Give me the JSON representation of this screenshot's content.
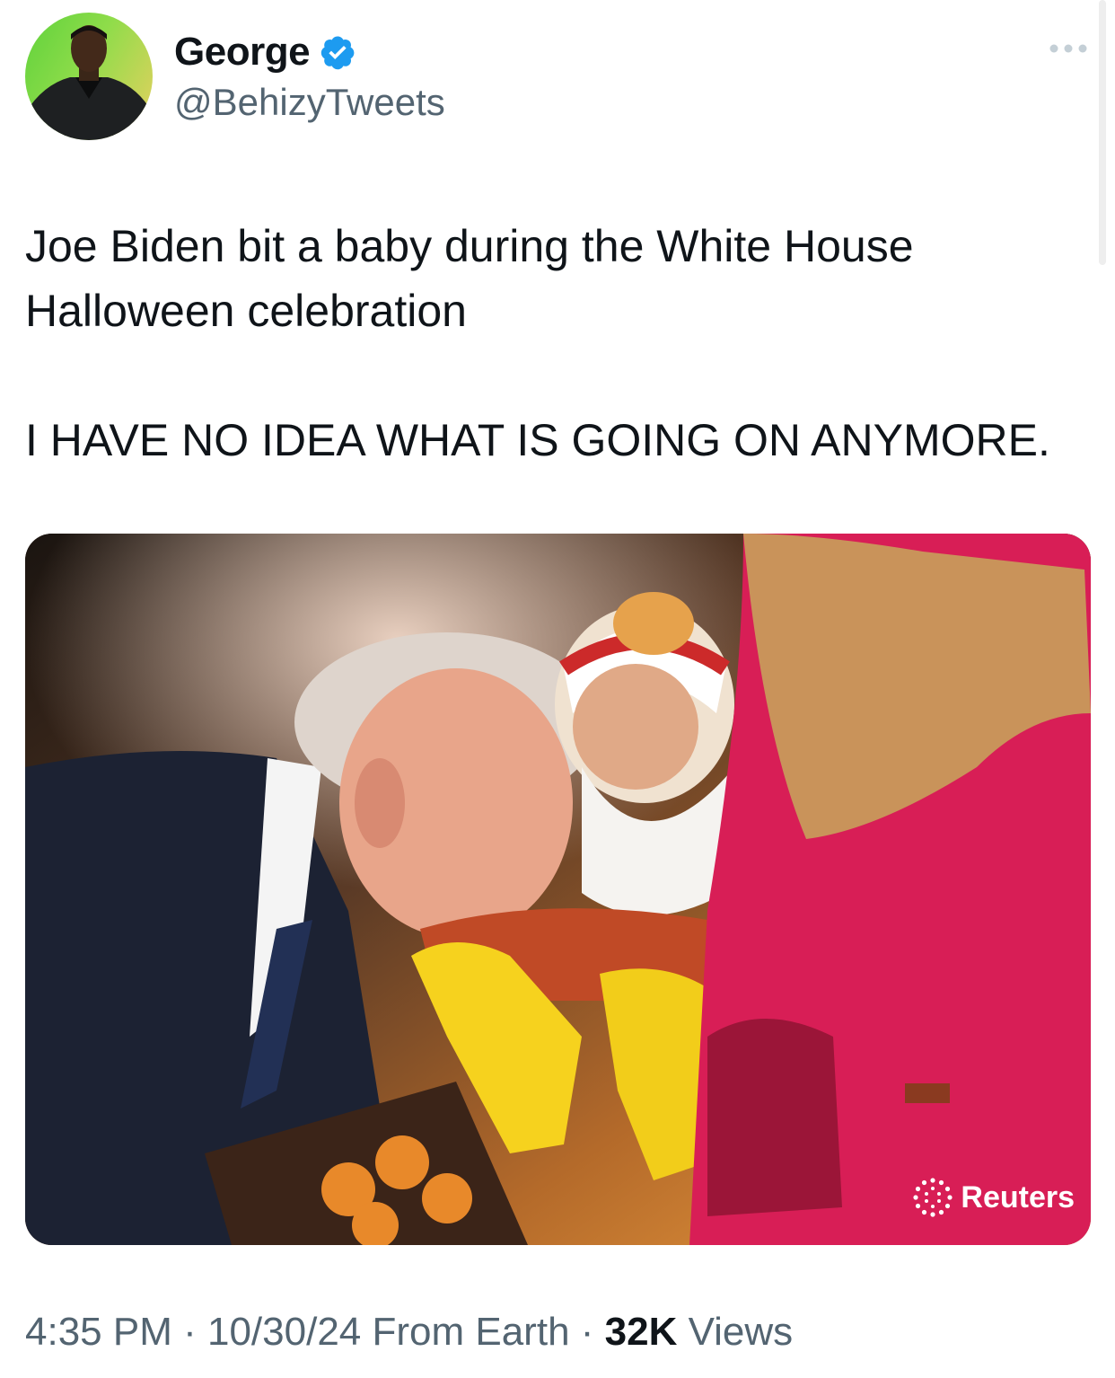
{
  "author": {
    "display_name": "George",
    "handle": "@BehizyTweets",
    "verified": true,
    "avatar_icon": "user-avatar"
  },
  "menu": {
    "more_icon": "more-horizontal-icon"
  },
  "tweet": {
    "line1": "Joe Biden bit a baby during the White House",
    "line2": "Halloween celebration",
    "line3": "I HAVE NO IDEA WHAT IS GOING ON ANYMORE."
  },
  "media": {
    "credit": "Reuters",
    "credit_icon": "reuters-logo-icon"
  },
  "footer": {
    "time": "4:35 PM",
    "sep1": " · ",
    "date": "10/30/24",
    "source": " From Earth",
    "sep2": " · ",
    "views_count": "32K",
    "views_label": " Views"
  },
  "colors": {
    "text": "#0f1419",
    "secondary": "#536471",
    "verified": "#1d9bf0"
  }
}
